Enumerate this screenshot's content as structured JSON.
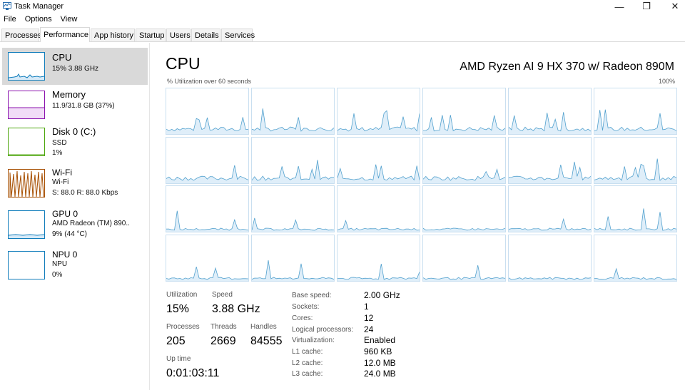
{
  "window": {
    "title": "Task Manager",
    "minimize_glyph": "—",
    "maximize_glyph": "❐",
    "close_glyph": "✕"
  },
  "menu": [
    "File",
    "Options",
    "View"
  ],
  "tabs": [
    {
      "label": "Processes",
      "active": false
    },
    {
      "label": "Performance",
      "active": true
    },
    {
      "label": "App history",
      "active": false
    },
    {
      "label": "Startup",
      "active": false
    },
    {
      "label": "Users",
      "active": false
    },
    {
      "label": "Details",
      "active": false
    },
    {
      "label": "Services",
      "active": false
    }
  ],
  "sidebar": {
    "items": [
      {
        "title": "CPU",
        "line1": "15% 3.88 GHz",
        "line2": "",
        "color": "#117dbb",
        "selected": true
      },
      {
        "title": "Memory",
        "line1": "11.9/31.8 GB (37%)",
        "line2": "",
        "color": "#8b12ae",
        "selected": false
      },
      {
        "title": "Disk 0 (C:)",
        "line1": "SSD",
        "line2": "1%",
        "color": "#4da60c",
        "selected": false
      },
      {
        "title": "Wi-Fi",
        "line1": "Wi-Fi",
        "line2": "S: 88.0 R: 88.0 Kbps",
        "color": "#a74f01",
        "selected": false
      },
      {
        "title": "GPU 0",
        "line1": "AMD Radeon (TM) 890..",
        "line2": "9% (44 °C)",
        "color": "#117dbb",
        "selected": false
      },
      {
        "title": "NPU 0",
        "line1": "NPU",
        "line2": "0%",
        "color": "#117dbb",
        "selected": false
      }
    ]
  },
  "main": {
    "title": "CPU",
    "cpu_name": "AMD Ryzen AI 9 HX 370 w/ Radeon 890M",
    "util_caption": "% Utilization over 60 seconds",
    "util_max": "100%",
    "graph_color": "#117dbb",
    "graph_fill": "#c9e2f5",
    "logical_processor_graphs": 24
  },
  "stats": {
    "utilization_label": "Utilization",
    "utilization": "15%",
    "speed_label": "Speed",
    "speed": "3.88 GHz",
    "processes_label": "Processes",
    "processes": "205",
    "threads_label": "Threads",
    "threads": "2669",
    "handles_label": "Handles",
    "handles": "84555",
    "uptime_label": "Up time",
    "uptime": "0:01:03:11"
  },
  "specs": [
    {
      "label": "Base speed:",
      "value": "2.00 GHz"
    },
    {
      "label": "Sockets:",
      "value": "1"
    },
    {
      "label": "Cores:",
      "value": "12"
    },
    {
      "label": "Logical processors:",
      "value": "24"
    },
    {
      "label": "Virtualization:",
      "value": "Enabled"
    },
    {
      "label": "L1 cache:",
      "value": "960 KB"
    },
    {
      "label": "L2 cache:",
      "value": "12.0 MB"
    },
    {
      "label": "L3 cache:",
      "value": "24.0 MB"
    }
  ]
}
